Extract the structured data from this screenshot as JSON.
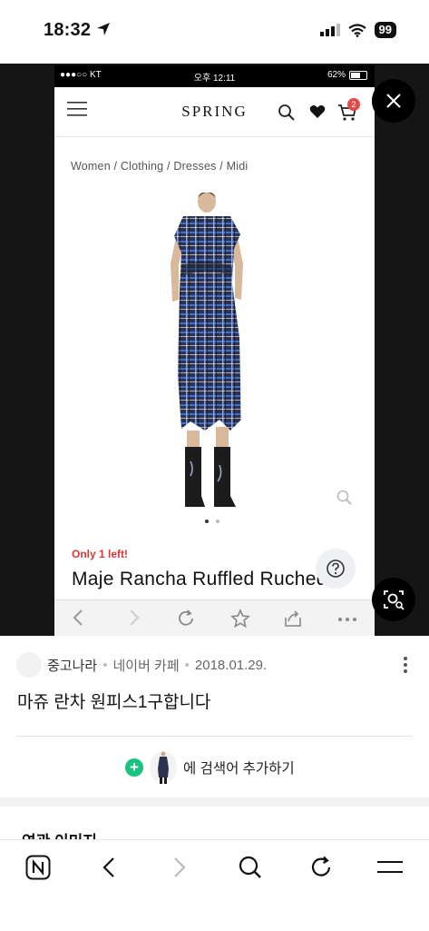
{
  "status_bar": {
    "time": "18:32",
    "battery": "99"
  },
  "inner_screenshot": {
    "status": {
      "carrier": "●●●○○ KT",
      "time": "오후 12:11",
      "battery": "62%"
    },
    "header": {
      "brand": "SPRING",
      "cart_count": "2"
    },
    "breadcrumb": "Women / Clothing / Dresses / Midi",
    "stock_note": "Only 1 left!",
    "product_title": "Maje Rancha Ruffled Ruched"
  },
  "result": {
    "source_name": "중고나라",
    "source_type": "네이버 카페",
    "date": "2018.01.29.",
    "title": "마쥬 란차 원피스1구합니다",
    "add_label": "에 검색어 추가하기",
    "related_title": "연관 이미지"
  },
  "colors": {
    "accent_green": "#19c37d",
    "badge_red": "#e14a4a",
    "stock_red": "#d53b3b",
    "plaid_navy": "#2b3350",
    "plaid_blue": "#3f6fd6"
  }
}
